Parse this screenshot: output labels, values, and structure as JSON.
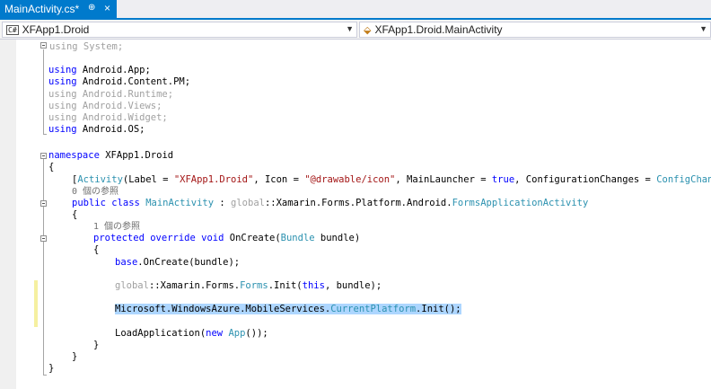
{
  "tab": {
    "title": "MainActivity.cs*",
    "pin": "⊕",
    "close": "×"
  },
  "nav": {
    "project": "XFApp1.Droid",
    "class": "XFApp1.Droid.MainActivity",
    "project_icon": "C#",
    "class_icon": "class-icon"
  },
  "code": {
    "l1": "using System;",
    "l3a": "using",
    "l3b": " Android.App;",
    "l4a": "using",
    "l4b": " Android.Content.PM;",
    "l5": "using Android.Runtime;",
    "l6": "using Android.Views;",
    "l7": "using Android.Widget;",
    "l8a": "using",
    "l8b": " Android.OS;",
    "l10a": "namespace",
    "l10b": " XFApp1.Droid",
    "l11": "{",
    "l12a": "[",
    "l12b": "Activity",
    "l12c": "(Label = ",
    "l12d": "\"XFApp1.Droid\"",
    "l12e": ", Icon = ",
    "l12f": "\"@drawable/icon\"",
    "l12g": ", MainLauncher = ",
    "l12h": "true",
    "l12i": ", ConfigurationChanges = ",
    "l12j": "ConfigChange",
    "l13": "0 個の参照",
    "l14a": "public",
    "l14b": " ",
    "l14c": "class",
    "l14d": " ",
    "l14e": "MainActivity",
    "l14f": " : ",
    "l14g": "global",
    "l14h": "::Xamarin.Forms.Platform.Android.",
    "l14i": "FormsApplicationActivity",
    "l15": "{",
    "l16": "1 個の参照",
    "l17a": "protected",
    "l17b": " ",
    "l17c": "override",
    "l17d": " ",
    "l17e": "void",
    "l17f": " OnCreate(",
    "l17g": "Bundle",
    "l17h": " bundle)",
    "l18": "{",
    "l19a": "base",
    "l19b": ".OnCreate(bundle);",
    "l21a": "global",
    "l21b": "::Xamarin.Forms.",
    "l21c": "Forms",
    "l21d": ".Init(",
    "l21e": "this",
    "l21f": ", bundle);",
    "l23a": "Microsoft.WindowsAzure.MobileServices.",
    "l23b": "CurrentPlatform",
    "l23c": ".Init();",
    "l25a": "LoadApplication(",
    "l25b": "new",
    "l25c": " ",
    "l25d": "App",
    "l25e": "());",
    "l26": "}",
    "l27": "}",
    "l28": "}"
  }
}
